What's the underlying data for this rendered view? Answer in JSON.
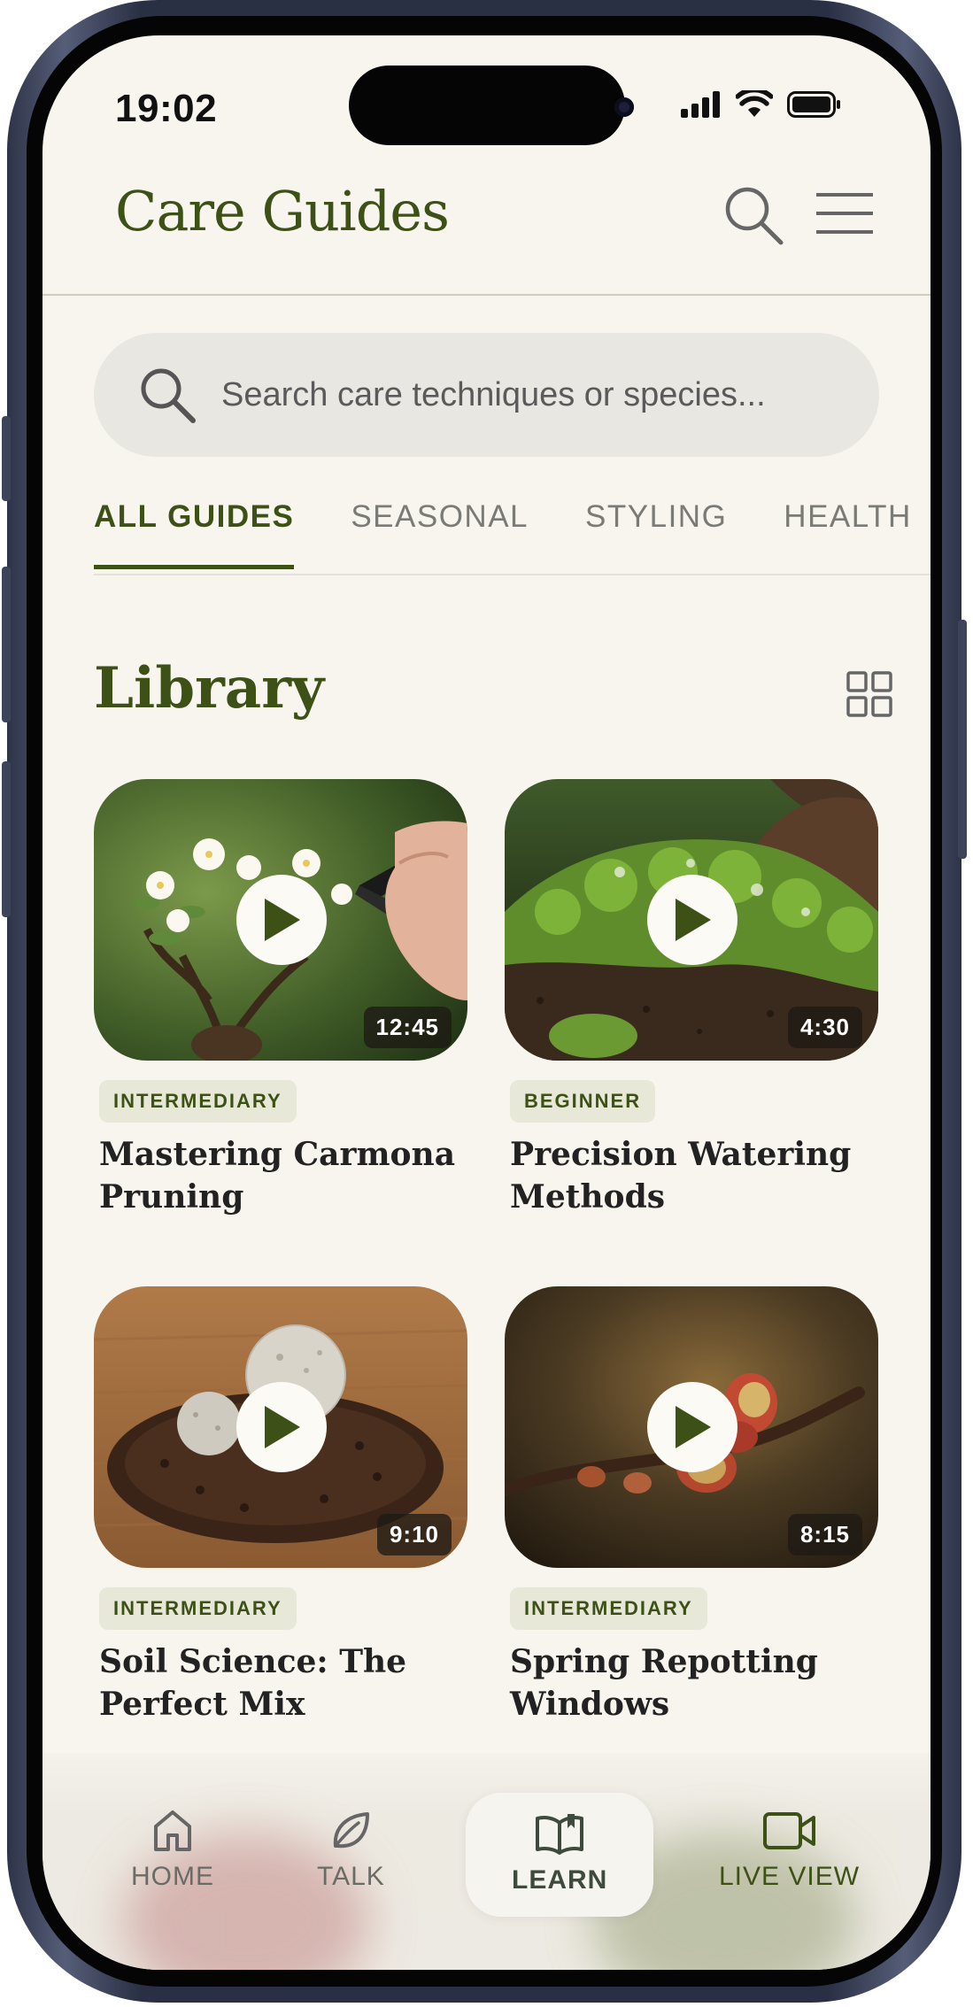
{
  "status_bar": {
    "time": "19:02"
  },
  "header": {
    "title": "Care Guides",
    "search_icon": "search-icon",
    "menu_icon": "hamburger-menu-icon"
  },
  "search": {
    "placeholder": "Search care techniques or species..."
  },
  "tabs": [
    {
      "label": "ALL GUIDES",
      "active": true
    },
    {
      "label": "SEASONAL",
      "active": false
    },
    {
      "label": "STYLING",
      "active": false
    },
    {
      "label": "HEALTH",
      "active": false
    }
  ],
  "library": {
    "title": "Library",
    "view_toggle_icon": "grid-view-icon",
    "videos": [
      {
        "level": "INTERMEDIARY",
        "title": "Mastering Carmona Pruning",
        "duration": "12:45"
      },
      {
        "level": "BEGINNER",
        "title": "Precision Watering Methods",
        "duration": "4:30"
      },
      {
        "level": "INTERMEDIARY",
        "title": "Soil Science: The Perfect Mix",
        "duration": "9:10"
      },
      {
        "level": "INTERMEDIARY",
        "title": "Spring Repotting Windows",
        "duration": "8:15"
      }
    ]
  },
  "bottom_nav": [
    {
      "label": "HOME",
      "icon": "home-icon",
      "active": false
    },
    {
      "label": "TALK",
      "icon": "leaf-icon",
      "active": false
    },
    {
      "label": "LEARN",
      "icon": "open-book-icon",
      "active": true
    },
    {
      "label": "LIVE VIEW",
      "icon": "video-camera-icon",
      "active": false
    }
  ],
  "colors": {
    "accent": "#3d5116",
    "background": "#f7f5ee",
    "badge": "#e7e8d8"
  }
}
